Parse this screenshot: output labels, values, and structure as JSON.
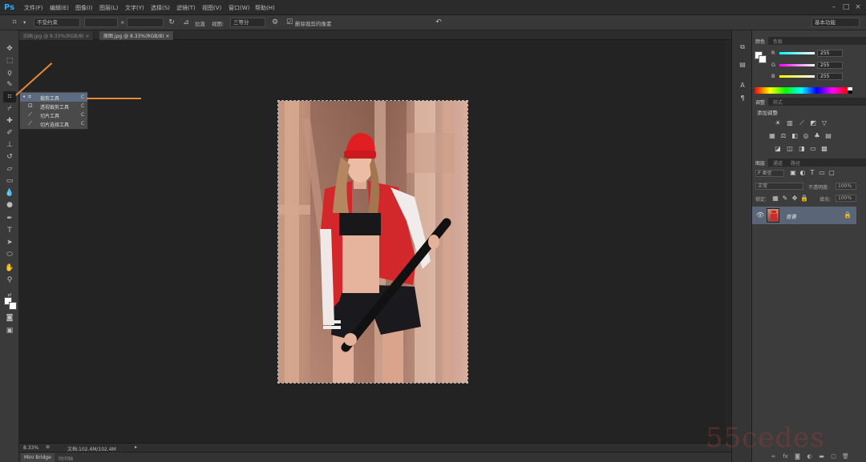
{
  "app": {
    "logo": "Ps"
  },
  "menu": {
    "items": [
      "文件(F)",
      "编辑(E)",
      "图像(I)",
      "图层(L)",
      "文字(Y)",
      "选择(S)",
      "滤镜(T)",
      "视图(V)",
      "窗口(W)",
      "帮助(H)"
    ]
  },
  "options_bar": {
    "ratio_label": "不受约束",
    "x_sep": "×",
    "straighten_label": "拉直",
    "view_label": "视图:",
    "view_value": "三等分",
    "delete_crop_label": "删除裁剪的像素",
    "workspace": "基本功能"
  },
  "tabs": [
    {
      "label": "旧画.jpg @ 8.33%(RGB/8) ×",
      "active": false
    },
    {
      "label": "原图.jpg @ 8.33%(RGB/8) ×",
      "active": true
    }
  ],
  "flyout": {
    "items": [
      {
        "label": "裁剪工具",
        "key": "C",
        "selected": true
      },
      {
        "label": "透视裁剪工具",
        "key": "C",
        "selected": false
      },
      {
        "label": "切片工具",
        "key": "C",
        "selected": false
      },
      {
        "label": "切片选择工具",
        "key": "C",
        "selected": false
      }
    ]
  },
  "status": {
    "zoom": "8.33%",
    "doc": "文档:102.4M/102.4M"
  },
  "bottom_tabs": [
    "Mini Bridge",
    "时间轴"
  ],
  "color_panel": {
    "tabs": [
      "颜色",
      "色板"
    ],
    "r_label": "R",
    "r_value": "255",
    "g_label": "G",
    "g_value": "255",
    "b_label": "B",
    "b_value": "255"
  },
  "adjust_panel": {
    "tabs": [
      "调整",
      "样式"
    ],
    "heading": "添加调整"
  },
  "layers_panel": {
    "tabs": [
      "图层",
      "通道",
      "路径"
    ],
    "filter_label": "P 类型",
    "blend_mode": "正常",
    "opacity_label": "不透明度:",
    "opacity_value": "100%",
    "lock_label": "锁定:",
    "fill_label": "填充:",
    "fill_value": "100%",
    "layer_name": "背景"
  },
  "watermark": "55cedes",
  "colors": {
    "accent_arrow": "#e68a3a",
    "selection_blue": "#5a6578",
    "jacket_red": "#d2272b"
  }
}
